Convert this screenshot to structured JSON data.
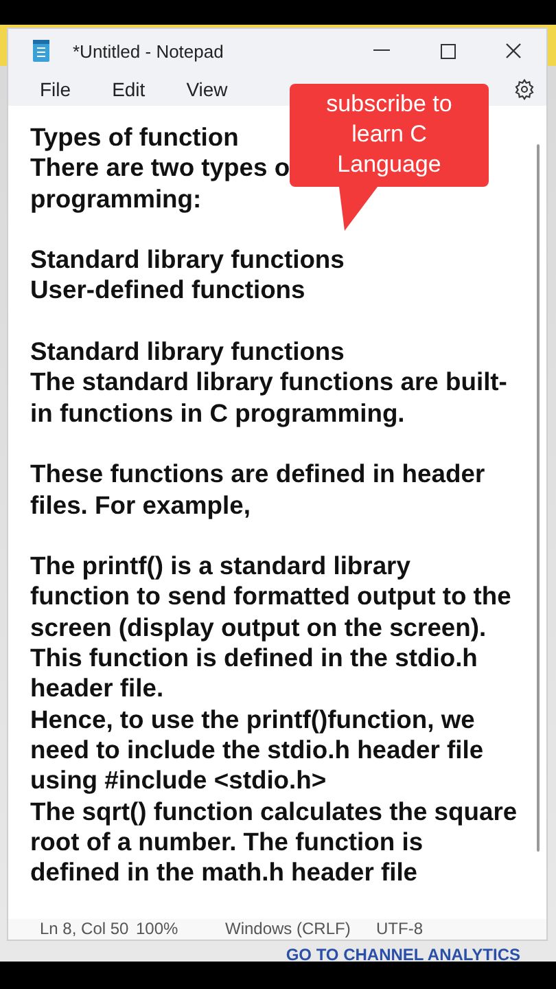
{
  "window": {
    "title": "*Untitled - Notepad"
  },
  "menu": [
    "File",
    "Edit",
    "View"
  ],
  "callout": {
    "lines": [
      "subscribe to",
      "learn C",
      "Language"
    ]
  },
  "paragraphs": [
    {
      "lines": [
        "Types of function",
        "There are two types o",
        "programming:"
      ]
    },
    {
      "lines": [
        "Standard library functions",
        "User-defined functions"
      ]
    },
    {
      "lines": [
        "Standard library functions",
        "The standard library functions are built-",
        "in functions in C programming."
      ]
    },
    {
      "lines": [
        "These functions are defined in header",
        "files. For example,"
      ]
    },
    {
      "lines": [
        "The printf() is a standard library",
        "function to send formatted output to the",
        "screen (display output on the screen).",
        "This function is defined in the stdio.h",
        "header file.",
        "Hence, to use the printf()function, we",
        "need to include the stdio.h header file",
        "using #include <stdio.h>",
        "The sqrt() function calculates the square",
        "root of a number. The function is",
        "defined in the math.h header file"
      ]
    }
  ],
  "status_bar": [
    "Ln 8, Col 50",
    "100%",
    "Windows (CRLF)",
    "UTF-8"
  ],
  "background_link": "GO TO CHANNEL ANALYTICS"
}
